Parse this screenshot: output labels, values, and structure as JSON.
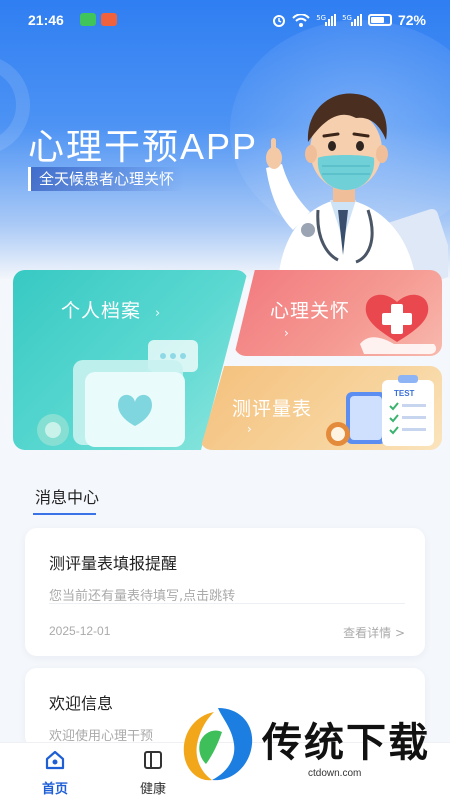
{
  "status_bar": {
    "time": "21:46",
    "network_tags": [
      "5G",
      "5G"
    ],
    "battery_level": 0.72,
    "battery": "72%"
  },
  "header": {
    "title": "心理干预APP",
    "subtitle": "全天候患者心理关怀"
  },
  "cards": {
    "profile": {
      "label": "个人档案",
      "chevron": "›"
    },
    "care": {
      "label": "心理关怀",
      "chevron": "›"
    },
    "scale": {
      "label": "测评量表",
      "chevron": "›",
      "test_tag": "TEST"
    }
  },
  "message_center": {
    "title": "消息中心",
    "messages": [
      {
        "title": "测评量表填报提醒",
        "desc": "您当前还有量表待填写,点击跳转",
        "date": "2025-12-01",
        "link": "查看详情 >"
      },
      {
        "title": "欢迎信息",
        "desc": "欢迎使用心理干预"
      }
    ]
  },
  "tabbar": {
    "tabs": [
      {
        "label": "首页",
        "icon": "home-icon",
        "active": true
      },
      {
        "label": "健康",
        "icon": "book-icon",
        "active": false
      }
    ]
  },
  "watermark": {
    "text": "传统下载",
    "url": "ctdown.com"
  },
  "colors": {
    "primary": "#2f7ef2",
    "accent_blue": "#1f5fd6",
    "card_teal": "#38c9c3",
    "card_red": "#f2797e",
    "card_orange": "#f4c07c"
  }
}
